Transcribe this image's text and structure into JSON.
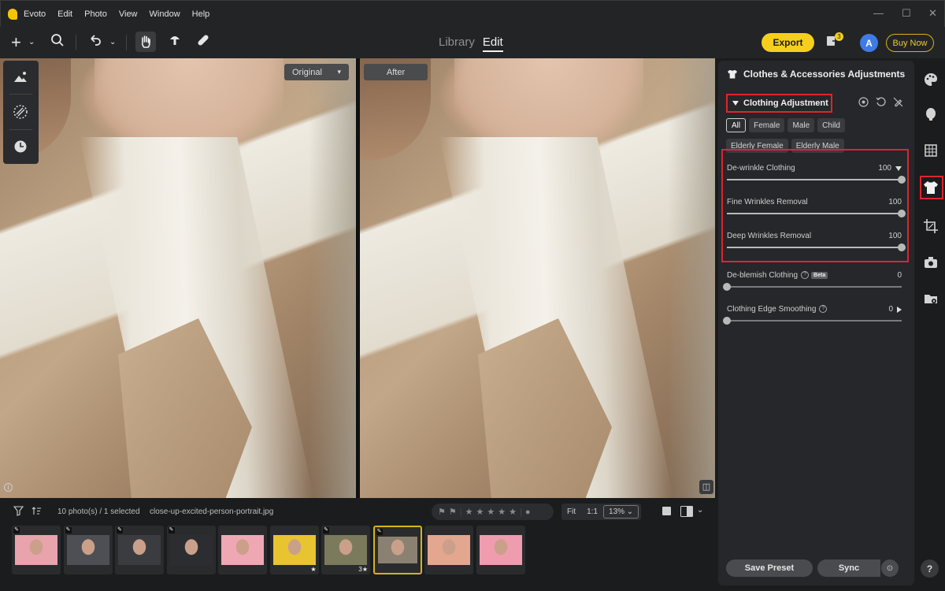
{
  "app": {
    "name": "Evoto"
  },
  "menu": [
    "Edit",
    "Photo",
    "View",
    "Window",
    "Help"
  ],
  "window_controls": {
    "minimize": "—",
    "maximize": "☐",
    "close": "✕"
  },
  "toolbar": {
    "tabs": [
      {
        "label": "Library",
        "active": false
      },
      {
        "label": "Edit",
        "active": true
      }
    ],
    "export_label": "Export",
    "notification_count": "3",
    "avatar_initial": "A",
    "buy_now_label": "Buy Now"
  },
  "canvas": {
    "original_label": "Original",
    "after_label": "After"
  },
  "panel": {
    "title": "Clothes & Accessories Adjustments",
    "section_title": "Clothing Adjustment",
    "chips": [
      {
        "label": "All",
        "active": true
      },
      {
        "label": "Female",
        "active": false
      },
      {
        "label": "Male",
        "active": false
      },
      {
        "label": "Child",
        "active": false
      },
      {
        "label": "Elderly Female",
        "active": false
      },
      {
        "label": "Elderly Male",
        "active": false
      }
    ],
    "sliders": [
      {
        "label": "De-wrinkle Clothing",
        "value": 100
      },
      {
        "label": "Fine Wrinkles Removal",
        "value": 100
      },
      {
        "label": "Deep Wrinkles Removal",
        "value": 100
      },
      {
        "label": "De-blemish Clothing",
        "value": 0,
        "badge": "Beta"
      },
      {
        "label": "Clothing Edge Smoothing",
        "value": 0
      }
    ],
    "save_preset_label": "Save Preset",
    "sync_label": "Sync"
  },
  "filmstrip": {
    "count_text": "10 photo(s) / 1 selected",
    "filename": "close-up-excited-person-portrait.jpg",
    "zoom_fit": "Fit",
    "zoom_1to1": "1:1",
    "zoom_level": "13%",
    "thumbnails": [
      {
        "bg": "#e9a3ad",
        "edited": true,
        "star": ""
      },
      {
        "bg": "#4d4f54",
        "edited": true,
        "star": ""
      },
      {
        "bg": "#3a3c40",
        "edited": true,
        "star": ""
      },
      {
        "bg": "#2c2d30",
        "edited": true,
        "star": ""
      },
      {
        "bg": "#f0a7b4",
        "edited": false,
        "star": ""
      },
      {
        "bg": "#e8c430",
        "edited": false,
        "star": "★"
      },
      {
        "bg": "#7c7a5c",
        "edited": true,
        "star": "3★"
      },
      {
        "bg": "#8a8172",
        "edited": true,
        "star": "",
        "selected": true
      },
      {
        "bg": "#e3a68f",
        "edited": false,
        "star": ""
      },
      {
        "bg": "#ef9cae",
        "edited": false,
        "star": ""
      }
    ]
  },
  "colors": {
    "accent": "#f5cf1b",
    "highlight_red": "#e0242c",
    "panel_bg": "#26272a"
  }
}
